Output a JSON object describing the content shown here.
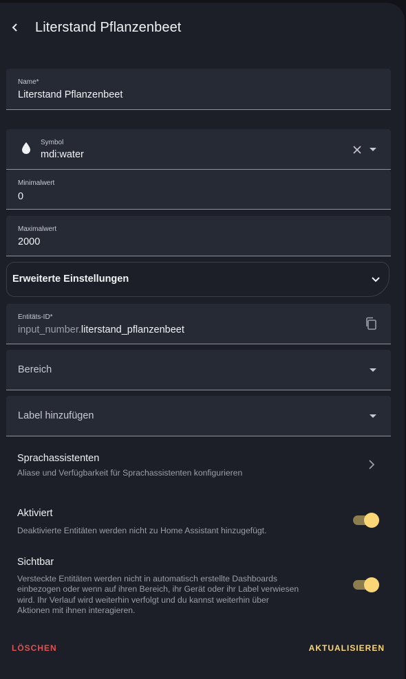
{
  "header": {
    "title": "Literstand Pflanzenbeet",
    "back_icon": "chevron-left-icon"
  },
  "fields": {
    "name": {
      "label": "Name*",
      "value": "Literstand Pflanzenbeet"
    },
    "symbol": {
      "label": "Symbol",
      "value": "mdi:water",
      "icon": "water-drop-icon"
    },
    "min": {
      "label": "Minimalwert",
      "value": "0"
    },
    "max": {
      "label": "Maximalwert",
      "value": "2000"
    }
  },
  "advanced": {
    "label": "Erweiterte Einstellungen",
    "expanded": false
  },
  "entity_id": {
    "label": "Entitäts-ID*",
    "prefix": "input_number.",
    "value": "literstand_pflanzenbeet",
    "copy_icon": "copy-icon"
  },
  "area": {
    "placeholder": "Bereich"
  },
  "labels": {
    "placeholder": "Label hinzufügen"
  },
  "voice": {
    "title": "Sprachassistenten",
    "subtitle": "Aliase und Verfügbarkeit für Sprachassistenten konfigurieren"
  },
  "enabled": {
    "title": "Aktiviert",
    "subtitle": "Deaktivierte Entitäten werden nicht zu Home Assistant hinzugefügt.",
    "on": true
  },
  "visible": {
    "title": "Sichtbar",
    "subtitle_lines": [
      "Versteckte Entitäten werden nicht in automatisch erstellte Dashboards",
      "einbezogen oder wenn auf ihren Bereich, ihr Gerät oder ihr Label verwiesen",
      "wird. Ihr Verlauf wird weiterhin verfolgt und du kannst weiterhin über",
      "Aktionen mit ihnen interagieren."
    ],
    "on": true
  },
  "footer": {
    "delete_label": "LÖSCHEN",
    "update_label": "AKTUALISIEREN"
  },
  "colors": {
    "background": "#1c1f27",
    "field": "#262a35",
    "accent": "#fbd676",
    "danger": "#e05151"
  }
}
